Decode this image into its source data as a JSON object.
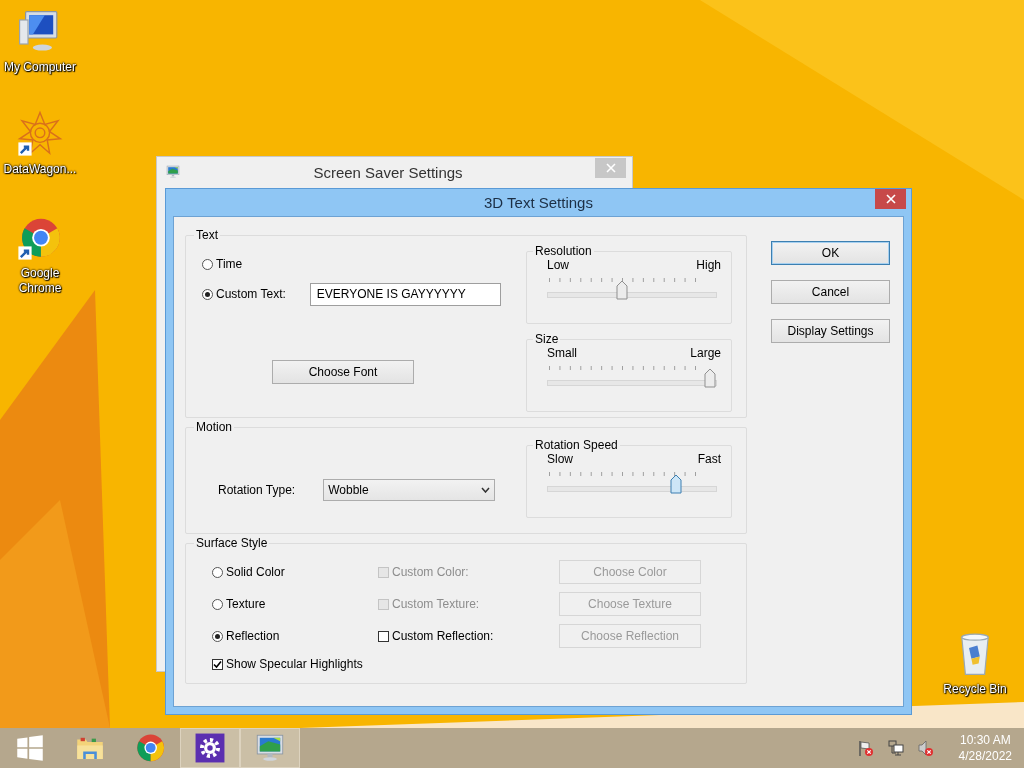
{
  "desktop": {
    "icons": [
      {
        "kind": "computer",
        "label": "My Computer",
        "shortcut": false
      },
      {
        "kind": "datawagon",
        "label": "DataWagon...",
        "shortcut": true
      },
      {
        "kind": "chrome",
        "label": "Google Chrome",
        "shortcut": true
      },
      {
        "kind": "recycle",
        "label": "Recycle Bin",
        "shortcut": false
      }
    ]
  },
  "background_window": {
    "title": "Screen Saver Settings"
  },
  "dialog": {
    "title": "3D Text Settings",
    "text_group": {
      "label": "Text",
      "options": [
        {
          "label": "Time",
          "selected": false
        },
        {
          "label": "Custom Text:",
          "selected": true
        }
      ],
      "custom_text": {
        "value": "EVERYONE IS GAYYYYYY"
      },
      "font_button": "Choose Font",
      "resolution": {
        "label": "Resolution",
        "low": "Low",
        "high": "High",
        "level": 0.44,
        "focused": false
      },
      "size": {
        "label": "Size",
        "low": "Small",
        "high": "Large",
        "level": 0.96,
        "focused": false
      }
    },
    "motion_group": {
      "label": "Motion",
      "rotation_label": "Rotation Type:",
      "rotation_value": "Wobble",
      "speed": {
        "label": "Rotation Speed",
        "low": "Slow",
        "high": "Fast",
        "level": 0.76,
        "focused": true
      }
    },
    "surface_group": {
      "label": "Surface Style",
      "rows": [
        {
          "option": {
            "label": "Solid Color",
            "selected": false
          },
          "custom": {
            "label": "Custom Color:",
            "checked": false,
            "disabled": true
          },
          "button": {
            "label": "Choose Color",
            "disabled": true
          }
        },
        {
          "option": {
            "label": "Texture",
            "selected": false
          },
          "custom": {
            "label": "Custom Texture:",
            "checked": false,
            "disabled": true
          },
          "button": {
            "label": "Choose Texture",
            "disabled": true
          }
        },
        {
          "option": {
            "label": "Reflection",
            "selected": true
          },
          "custom": {
            "label": "Custom Reflection:",
            "checked": false,
            "disabled": false
          },
          "button": {
            "label": "Choose Reflection",
            "disabled": true
          }
        }
      ],
      "specular": {
        "label": "Show Specular Highlights",
        "checked": true
      }
    },
    "buttons": [
      {
        "label": "OK",
        "default": true
      },
      {
        "label": "Cancel",
        "default": false
      },
      {
        "label": "Display Settings",
        "default": false
      }
    ]
  },
  "taskbar": {
    "items": [
      {
        "kind": "start",
        "selected": false
      },
      {
        "kind": "explorer",
        "selected": false
      },
      {
        "kind": "chrome",
        "selected": false
      },
      {
        "kind": "settings",
        "selected": true
      },
      {
        "kind": "screensaver",
        "selected": true
      }
    ],
    "tray": [
      {
        "kind": "flag"
      },
      {
        "kind": "network"
      },
      {
        "kind": "speaker"
      }
    ],
    "time": "10:30 AM",
    "date": "4/28/2022"
  }
}
